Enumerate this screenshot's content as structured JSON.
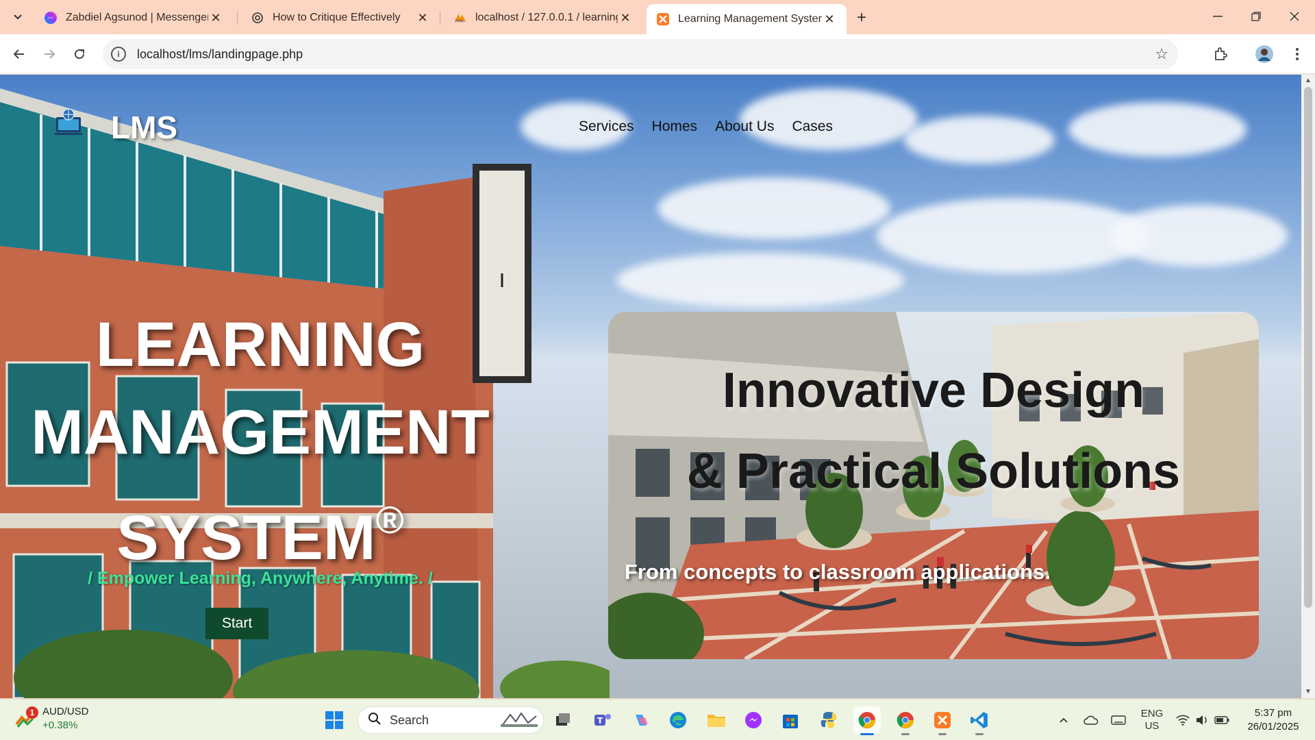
{
  "browser": {
    "tabs": [
      {
        "title": "Zabdiel Agsunod | Messenger",
        "icon": "messenger-icon"
      },
      {
        "title": "How to Critique Effectively",
        "icon": "chatgpt-icon"
      },
      {
        "title": "localhost / 127.0.0.1 / learning_",
        "icon": "phpmyadmin-icon"
      },
      {
        "title": "Learning Management System",
        "icon": "xampp-icon",
        "active": true
      }
    ],
    "url": "localhost/lms/landingpage.php"
  },
  "site": {
    "brand": "LMS",
    "nav": [
      "Services",
      "Homes",
      "About Us",
      "Cases"
    ],
    "hero": {
      "line1": "LEARNING",
      "line2": "MANAGEMENT",
      "line3": "SYSTEM",
      "mark": "®"
    },
    "tagline": "/ Empower Learning, Anywhere, Anytime. /",
    "start_label": "Start",
    "card": {
      "title_line1": "Innovative Design",
      "title_line2": "& Practical Solutions",
      "subtitle": "From concepts to classroom applications."
    }
  },
  "taskbar": {
    "widget": {
      "pair": "AUD/USD",
      "change": "+0.38%",
      "badge": "1"
    },
    "search_label": "Search",
    "lang": {
      "line1": "ENG",
      "line2": "US"
    },
    "time": "5:37 pm",
    "date": "26/01/2025"
  },
  "colors": {
    "tabstrip": "#fcd6c3",
    "tagline": "#39e39a",
    "start_button": "#0f4a2c",
    "taskbar": "#eef4e2"
  }
}
